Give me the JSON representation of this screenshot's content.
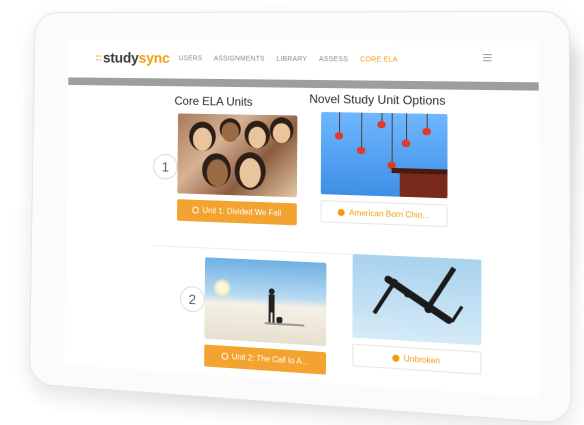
{
  "nav": {
    "logo_text": "study",
    "logo_accent": "sync",
    "logo_dots": "::",
    "items": [
      "USERS",
      "ASSIGNMENTS",
      "LIBRARY",
      "ASSESS",
      "CORE ELA"
    ],
    "active_index": 4
  },
  "columns": {
    "core_title": "Core ELA Units",
    "novel_title": "Novel Study Unit Options"
  },
  "rows": [
    {
      "number": "1",
      "core_button": "Unit 1: Divided We Fall",
      "novel_button": "American Born Chin..."
    },
    {
      "number": "2",
      "core_button": "Unit 2: The Call to A...",
      "novel_button": "Unbroken"
    }
  ],
  "colors": {
    "accent": "#f39c12",
    "button_orange": "#f3a32f",
    "nav_bar_gray": "#9e9e9e"
  },
  "icons": {
    "button_icon": "play-circle-icon",
    "menu_icon": "hamburger-menu-icon"
  }
}
